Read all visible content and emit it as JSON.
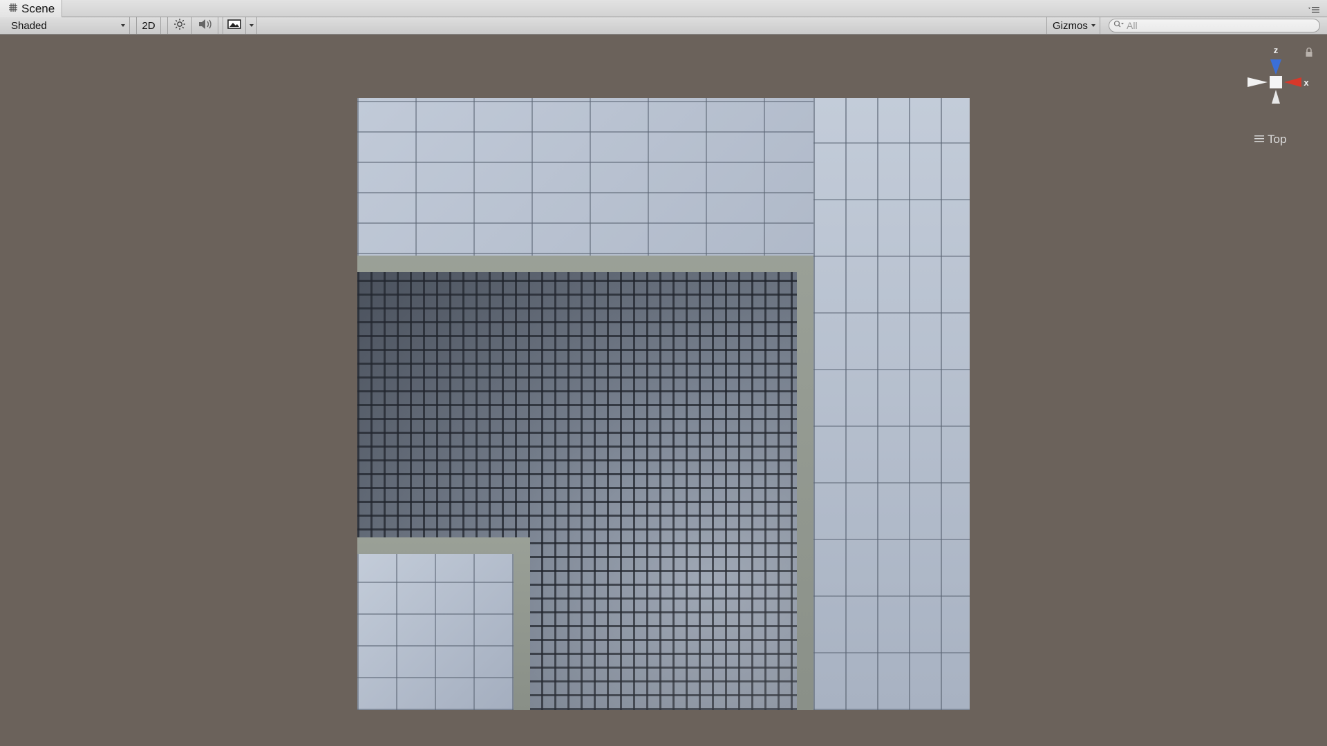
{
  "window": {
    "tab_title": "Scene",
    "tab_icon": "grid-hash-icon",
    "menu_icon": "panel-menu-icon"
  },
  "toolbar": {
    "draw_mode": "Shaded",
    "mode_2d_label": "2D",
    "lighting_icon": "sun-icon",
    "audio_icon": "speaker-icon",
    "effects_icon": "image-icon",
    "gizmos_label": "Gizmos",
    "search_placeholder": "All"
  },
  "viewport": {
    "background_color": "#6b625b",
    "texture_name": "stone-pavement-texture"
  },
  "orientation_gizmo": {
    "z_label": "z",
    "x_label": "x",
    "view_label": "Top",
    "colors": {
      "z": "#3b6fd8",
      "x": "#d8382a",
      "neutral": "#f2f2f2"
    }
  }
}
